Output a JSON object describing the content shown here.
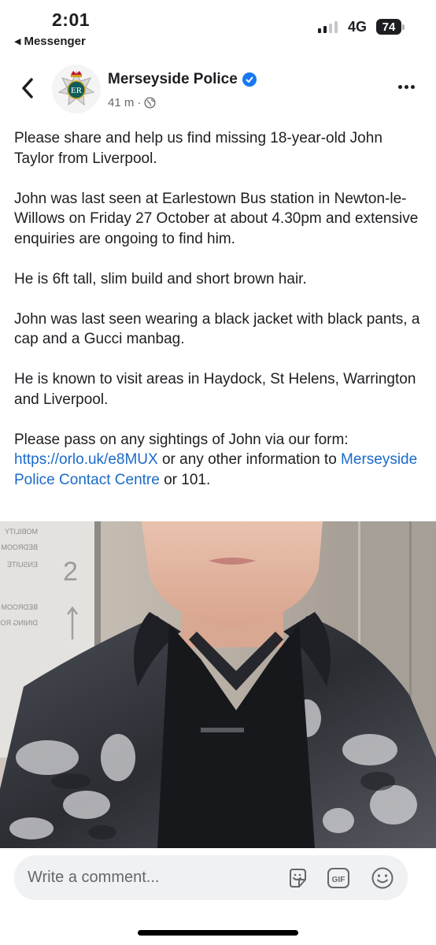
{
  "status_bar": {
    "time": "2:01",
    "back_app": "Messenger",
    "network": "4G",
    "battery": "74"
  },
  "post": {
    "page_name": "Merseyside Police",
    "time_ago": "41 m",
    "separator": "·",
    "avatar_text": "ER",
    "avatar_label": "POLICE",
    "paragraphs": {
      "p1": "Please share and help us find missing 18-year-old John Taylor from Liverpool.",
      "p2": "John was last seen at Earlestown Bus station in Newton-le-Willows on Friday 27 October at about 4.30pm and extensive enquiries are ongoing to find him.",
      "p3": "He is 6ft tall, slim build and short brown hair.",
      "p4": "John was last seen wearing a black jacket with black pants, a cap and a Gucci manbag.",
      "p5": "He is known to visit areas in Haydock, St Helens, Warrington and Liverpool.",
      "p6_before_link": "Please pass on any sightings of John via our form: ",
      "p6_link1": "https://orlo.uk/e8MUX",
      "p6_middle": " or any other information to ",
      "p6_link2": "Merseyside Police Contact Centre",
      "p6_end": " or 101."
    }
  },
  "photo": {
    "sign_lines": [
      "MOBILITY",
      "BEDROOM",
      "ENSUITE",
      "BEDROOM",
      "DINING ROOM"
    ],
    "sign_number": "2"
  },
  "comment_bar": {
    "placeholder": "Write a comment...",
    "gif_label": "GIF"
  },
  "colors": {
    "link": "#1b6ac9",
    "verified": "#1877f2",
    "meta": "#65676b",
    "comment_bg": "#eff1f3"
  },
  "icons": [
    "back-chevron-icon",
    "verified-badge-icon",
    "globe-icon",
    "more-options-icon",
    "sticker-icon",
    "gif-icon",
    "emoji-icon"
  ]
}
